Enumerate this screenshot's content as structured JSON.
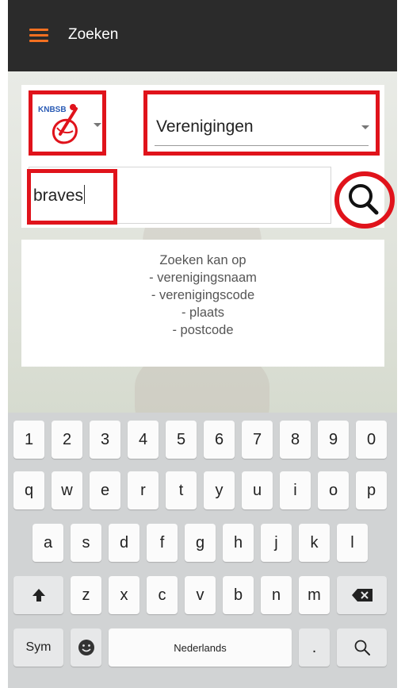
{
  "app": {
    "title": "Zoeken",
    "accent_color": "#f37021",
    "appbar_color": "#2b2b2b",
    "menu_icon": "hamburger-menu-icon"
  },
  "search": {
    "federation_logo": "KNBSB",
    "type_value": "Verenigingen",
    "query_value": "braves",
    "search_icon": "magnifier-icon",
    "highlight_color": "#e0131b"
  },
  "info": {
    "lines": [
      "Zoeken kan op",
      "- verenigingsnaam",
      "- verenigingscode",
      "- plaats",
      "- postcode"
    ]
  },
  "keyboard": {
    "row_numbers": [
      "1",
      "2",
      "3",
      "4",
      "5",
      "6",
      "7",
      "8",
      "9",
      "0"
    ],
    "row_1": [
      "q",
      "w",
      "e",
      "r",
      "t",
      "y",
      "u",
      "i",
      "o",
      "p"
    ],
    "row_2": [
      "a",
      "s",
      "d",
      "f",
      "g",
      "h",
      "j",
      "k",
      "l"
    ],
    "row_3": [
      "z",
      "x",
      "c",
      "v",
      "b",
      "n",
      "m"
    ],
    "sym_label": "Sym",
    "space_label": "Nederlands",
    "period_label": ".",
    "shift_icon": "shift-arrow-icon",
    "backspace_icon": "backspace-icon",
    "emoji_icon": "emoji-icon",
    "search_key_icon": "search-icon"
  }
}
